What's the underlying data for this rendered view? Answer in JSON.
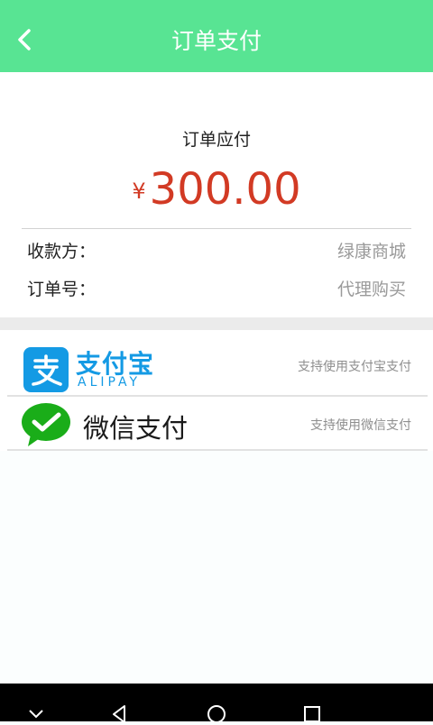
{
  "header": {
    "title": "订单支付",
    "back_icon": "chevron-left-icon"
  },
  "summary": {
    "due_label": "订单应付",
    "currency_symbol": "¥",
    "amount": "300.00",
    "payee_label": "收款方：",
    "payee_value": "绿康商城",
    "order_no_label": "订单号：",
    "order_no_value": "代理购买"
  },
  "payment_methods": [
    {
      "id": "alipay",
      "name": "支付宝",
      "sub_label": "ALIPAY",
      "description": "支持使用支付宝支付",
      "icon": "alipay-icon"
    },
    {
      "id": "wechat",
      "name": "微信支付",
      "description": "支持使用微信支付",
      "icon": "wechat-pay-icon"
    }
  ],
  "system_nav": {
    "icons": [
      "chevron-down-icon",
      "nav-back-icon",
      "nav-home-icon",
      "nav-recents-icon"
    ]
  },
  "colors": {
    "header_bg": "#58e493",
    "amount_red": "#d23a24",
    "alipay_blue": "#149ae4",
    "wechat_green": "#1aad19"
  }
}
